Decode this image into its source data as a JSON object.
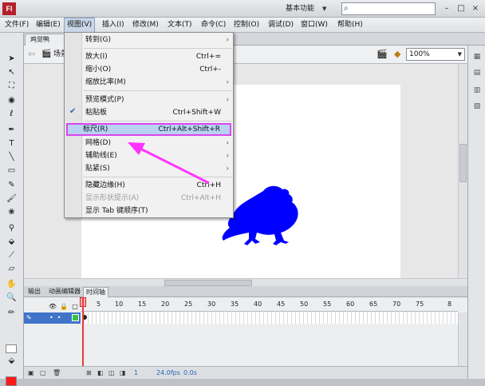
{
  "app": {
    "logo_text": "Fl",
    "workspace_label": "基本功能"
  },
  "window_controls": {
    "minimize": "–",
    "restore": "□",
    "close": "×"
  },
  "menubar": [
    {
      "label": "文件(F)"
    },
    {
      "label": "编辑(E)"
    },
    {
      "label": "视图(V)",
      "active": true
    },
    {
      "label": "插入(I)"
    },
    {
      "label": "修改(M)"
    },
    {
      "label": "文本(T)"
    },
    {
      "label": "命令(C)"
    },
    {
      "label": "控制(O)"
    },
    {
      "label": "调试(D)"
    },
    {
      "label": "窗口(W)"
    },
    {
      "label": "帮助(H)"
    }
  ],
  "document": {
    "tab_label": "鸡觉鸭",
    "scene_label": "场景",
    "zoom_value": "100%"
  },
  "view_menu": {
    "items": [
      {
        "label": "转到(G)",
        "shortcut": "",
        "submenu": true
      },
      {
        "label": "放大(I)",
        "shortcut": "Ctrl+="
      },
      {
        "label": "缩小(O)",
        "shortcut": "Ctrl+-"
      },
      {
        "label": "缩放比率(M)",
        "shortcut": "",
        "submenu": true
      },
      {
        "label": "预览模式(P)",
        "shortcut": "",
        "submenu": true
      },
      {
        "label": "粘贴板",
        "shortcut": "Ctrl+Shift+W",
        "checked": true
      },
      {
        "label": "标尺(R)",
        "shortcut": "Ctrl+Alt+Shift+R",
        "highlighted": true
      },
      {
        "label": "网格(D)",
        "shortcut": "",
        "submenu": true
      },
      {
        "label": "辅助线(E)",
        "shortcut": "",
        "submenu": true
      },
      {
        "label": "贴紧(S)",
        "shortcut": "",
        "submenu": true
      },
      {
        "label": "隐藏边缘(H)",
        "shortcut": "Ctrl+H"
      },
      {
        "label": "显示形状提示(A)",
        "shortcut": "Ctrl+Alt+H",
        "disabled": true
      },
      {
        "label": "显示 Tab 键顺序(T)",
        "shortcut": ""
      }
    ]
  },
  "timeline": {
    "tabs": [
      "输出",
      "动画编辑器",
      "时间轴"
    ],
    "frame_numbers": [
      "1",
      "5",
      "10",
      "15",
      "20",
      "25",
      "30",
      "35",
      "40",
      "45",
      "50",
      "55",
      "60",
      "65",
      "70",
      "75",
      "8"
    ],
    "status": {
      "frame": "1",
      "fps": "24.0fps",
      "time": "0.0s"
    }
  },
  "colors": {
    "accent_highlight": "#d946ef",
    "shape_fill": "#0000ff",
    "layer_selected": "#3f74c9"
  }
}
